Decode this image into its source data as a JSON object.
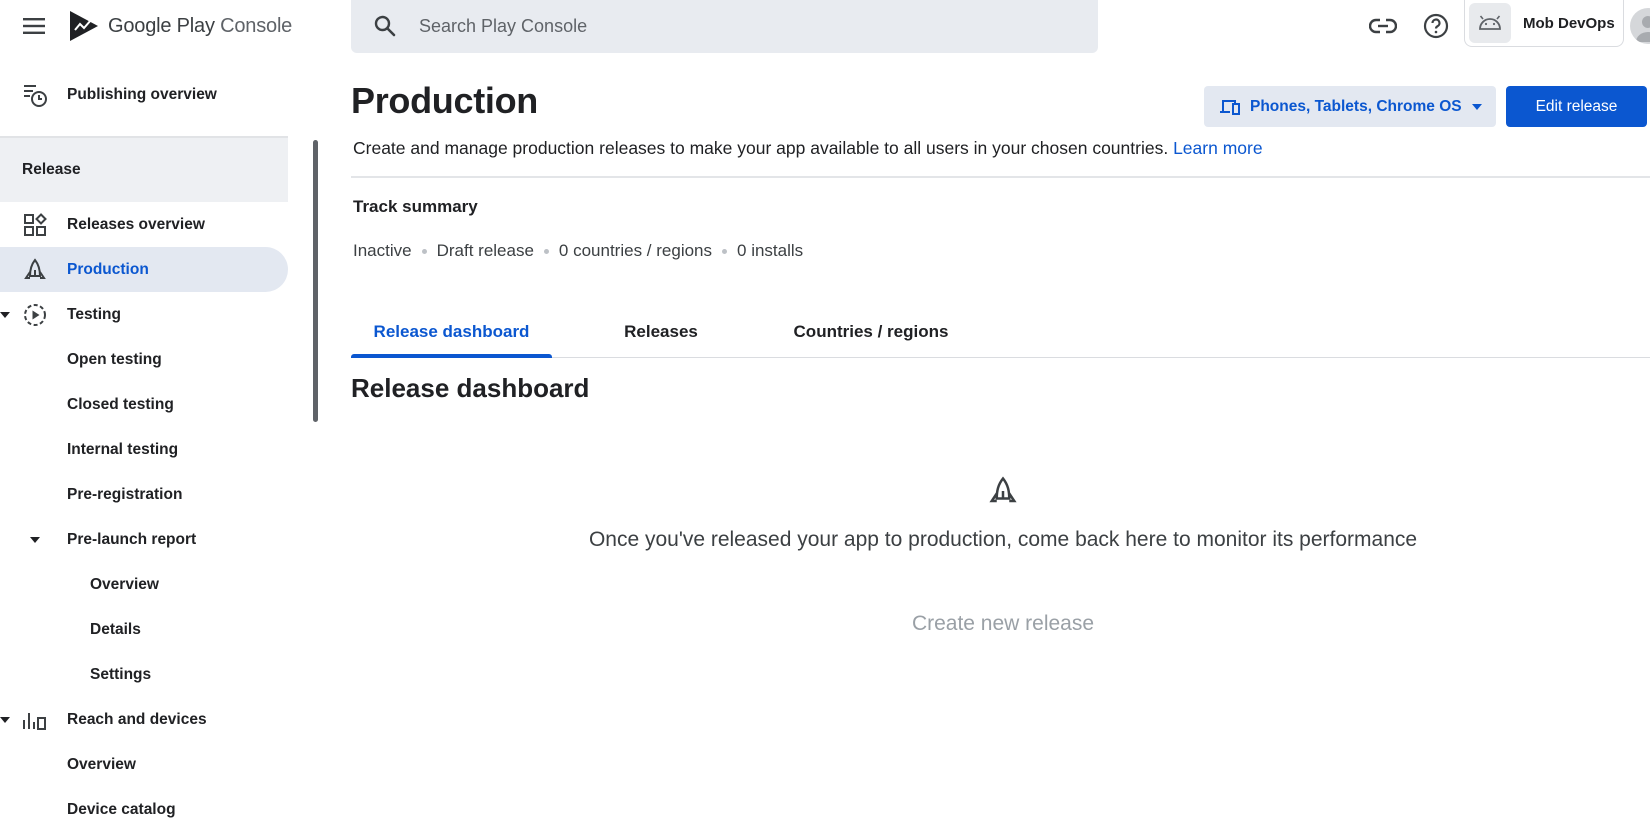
{
  "topbar": {
    "logo_brand": "Google Play",
    "logo_product": "Console",
    "search_placeholder": "Search Play Console",
    "account_name": "Mob DevOps"
  },
  "sidebar": {
    "publishing_overview": "Publishing overview",
    "section_release": "Release",
    "items": {
      "releases_overview": "Releases overview",
      "production": "Production",
      "testing": "Testing",
      "open_testing": "Open testing",
      "closed_testing": "Closed testing",
      "internal_testing": "Internal testing",
      "pre_registration": "Pre-registration",
      "pre_launch_report": "Pre-launch report",
      "prl_overview": "Overview",
      "prl_details": "Details",
      "prl_settings": "Settings",
      "reach_and_devices": "Reach and devices",
      "rd_overview": "Overview",
      "device_catalog": "Device catalog"
    }
  },
  "main": {
    "title": "Production",
    "device_selector": "Phones, Tablets, Chrome OS",
    "edit_release": "Edit release",
    "description": "Create and manage production releases to make your app available to all users in your chosen countries.",
    "learn_more": "Learn more",
    "track_summary": {
      "title": "Track summary",
      "status": "Inactive",
      "release_state": "Draft release",
      "countries": "0 countries / regions",
      "installs": "0 installs"
    },
    "tabs": [
      "Release dashboard",
      "Releases",
      "Countries / regions"
    ],
    "section_title": "Release dashboard",
    "empty_message": "Once you've released your app to production, come back here to monitor its performance",
    "create_new_release": "Create new release"
  },
  "colors": {
    "accent": "#0b57d0",
    "active_nav_bg": "#e3e8f1",
    "search_bg": "#e8ebf0"
  },
  "icons": {
    "menu": "hamburger-menu-icon",
    "logo": "play-console-logo",
    "search": "search-icon",
    "link": "link-icon",
    "help": "help-icon",
    "android": "android-icon",
    "publishing": "publishing-overview-icon",
    "releases_overview": "dashboard-icon",
    "production": "rocket-icon",
    "testing": "testing-icon",
    "reach": "bar-chart-icon",
    "devices": "devices-icon"
  }
}
